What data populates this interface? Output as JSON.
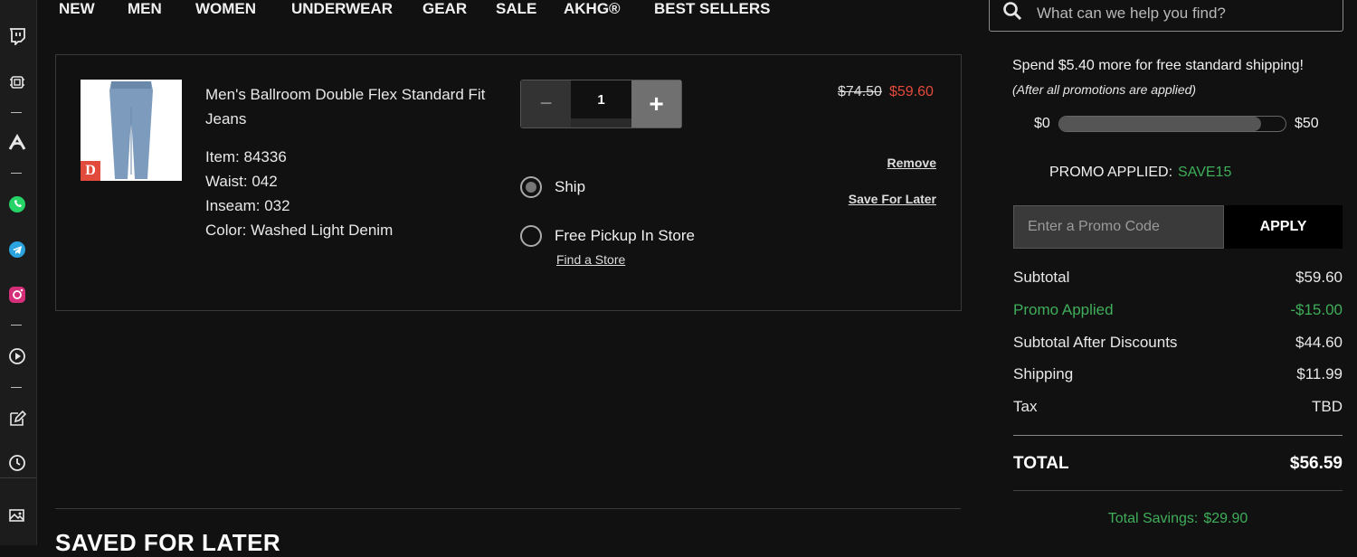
{
  "nav": {
    "items": [
      "NEW",
      "MEN",
      "WOMEN",
      "UNDERWEAR",
      "GEAR",
      "SALE",
      "AKHG®",
      "BEST SELLERS"
    ]
  },
  "search": {
    "placeholder": "What can we help you find?"
  },
  "rail_icons": [
    "twitch-icon",
    "chip-icon",
    "arc-icon",
    "whatsapp-icon",
    "telegram-icon",
    "instagram-icon",
    "play-circle-icon",
    "edit-icon",
    "history-icon",
    "gallery-icon"
  ],
  "item": {
    "name": "Men's Ballroom Double Flex Standard Fit Jeans",
    "item_label": "Item: 84336",
    "waist_label": "Waist: 042",
    "inseam_label": "Inseam: 032",
    "color_label": "Color: Washed Light Denim",
    "brand_badge": "D",
    "quantity": "1",
    "minus": "−",
    "plus": "+",
    "ship_label": "Ship",
    "pickup_label": "Free Pickup In Store",
    "find_store": "Find a Store",
    "old_price": "$74.50",
    "new_price": "$59.60",
    "remove": "Remove",
    "save_for_later": "Save For Later"
  },
  "saved_title": "SAVED FOR LATER",
  "summary": {
    "shipping_message": "Spend $5.40 more for free standard shipping!",
    "shipping_note": "(After all promotions are applied)",
    "progress_min": "$0",
    "progress_max": "$50",
    "progress_fraction": 0.892,
    "promo_applied_label": "PROMO APPLIED:",
    "promo_code": "SAVE15",
    "promo_placeholder": "Enter a Promo Code",
    "apply": "APPLY",
    "rows": [
      {
        "label": "Subtotal",
        "value": "$59.60"
      },
      {
        "label": "Promo Applied",
        "value": "-$15.00"
      },
      {
        "label": "Subtotal After Discounts",
        "value": "$44.60"
      },
      {
        "label": "Shipping",
        "value": "$11.99"
      },
      {
        "label": "Tax",
        "value": "TBD"
      }
    ],
    "total_label": "TOTAL",
    "total_value": "$56.59",
    "savings_label": "Total Savings:",
    "savings_value": "$29.90"
  },
  "colors": {
    "accent_red": "#e24a3b",
    "accent_green": "#3fae5a",
    "background": "#111111"
  }
}
